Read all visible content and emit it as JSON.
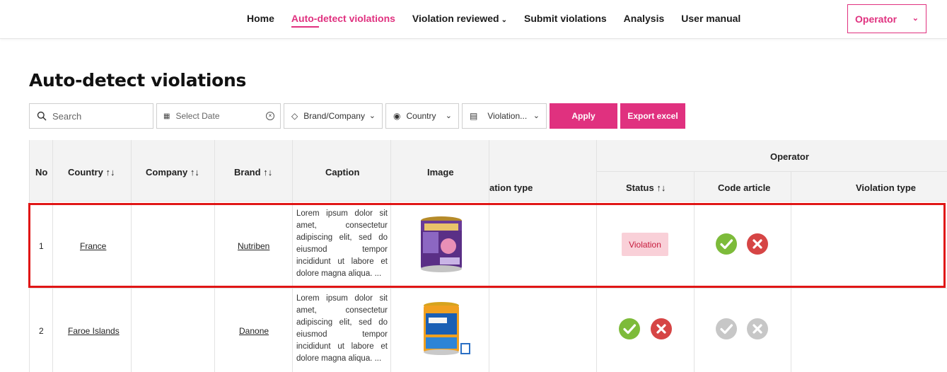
{
  "nav": {
    "items": [
      {
        "label": "Home"
      },
      {
        "label": "Auto-detect violations",
        "active": true
      },
      {
        "label": "Violation reviewed",
        "has_dropdown": true
      },
      {
        "label": "Submit violations"
      },
      {
        "label": "Analysis"
      },
      {
        "label": "User manual"
      }
    ],
    "role_select": {
      "value": "Operator"
    }
  },
  "page_title": "Auto-detect violations",
  "filters": {
    "search_placeholder": "Search",
    "date_placeholder": "Select Date",
    "brand_label": "Brand/Company",
    "country_label": "Country",
    "violation_label": "Violation...",
    "apply_label": "Apply",
    "export_label": "Export excel"
  },
  "table": {
    "headers": {
      "no": "No",
      "country": "Country",
      "company": "Company",
      "brand": "Brand",
      "caption": "Caption",
      "image": "Image",
      "violation_type_partial": "ation type",
      "group": "Operator",
      "status": "Status",
      "code_article": "Code article",
      "violation_type": "Violation type",
      "sort_glyph": "↑↓"
    },
    "rows": [
      {
        "no": "1",
        "country": "France",
        "company": "",
        "brand": "Nutriben",
        "caption": "Lorem ipsum dolor sit amet, consectetur adipiscing elit, sed do eiusmod tempor incididunt ut labore et dolore magna aliqua. ...",
        "status": "Violation",
        "selected": true
      },
      {
        "no": "2",
        "country": "Faroe Islands",
        "company": "",
        "brand": "Danone",
        "caption": "Lorem ipsum dolor sit amet, consectetur adipiscing elit, sed do eiusmod tempor incididunt ut labore et dolore magna aliqua. ...",
        "status": "",
        "selected": false
      }
    ]
  },
  "colors": {
    "accent": "#e0317f",
    "approve": "#7dbb3a",
    "reject": "#d64545",
    "disabled": "#c7c7c7",
    "violation_badge_bg": "#f9d0d8",
    "highlight": "#e01616"
  }
}
